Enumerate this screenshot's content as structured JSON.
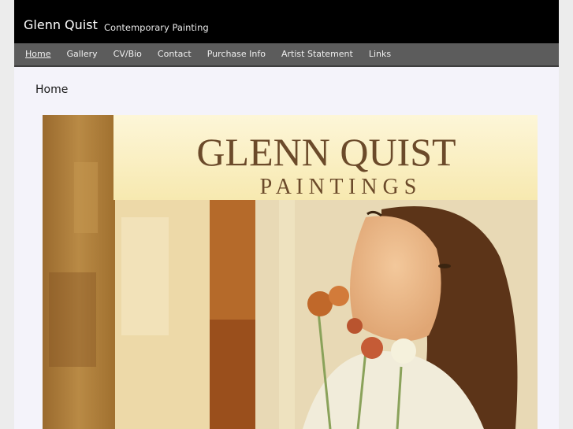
{
  "site": {
    "title": "Glenn Quist",
    "tagline": "Contemporary Painting"
  },
  "nav": [
    {
      "label": "Home",
      "active": true
    },
    {
      "label": "Gallery"
    },
    {
      "label": "CV/Bio"
    },
    {
      "label": "Contact"
    },
    {
      "label": "Purchase Info"
    },
    {
      "label": "Artist Statement"
    },
    {
      "label": "Links"
    }
  ],
  "page": {
    "title": "Home"
  },
  "banner": {
    "line1": "GLENN QUIST",
    "line2": "P A I N T I N G S"
  },
  "colors": {
    "header_bg": "#000000",
    "nav_bg": "#5c5c5c",
    "page_bg": "#f4f3fa",
    "banner_text": "#6b4a2a"
  }
}
